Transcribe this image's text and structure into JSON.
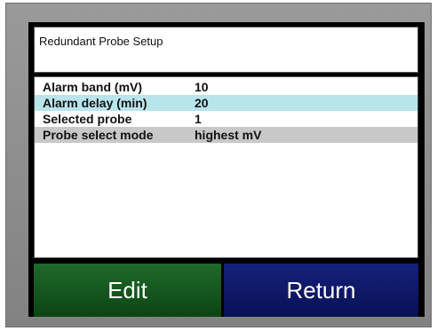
{
  "screen": {
    "title": "Redundant Probe Setup"
  },
  "settings": [
    {
      "label": "Alarm band (mV)",
      "value": "10"
    },
    {
      "label": "Alarm delay (min)",
      "value": "20"
    },
    {
      "label": "Selected probe",
      "value": "1"
    },
    {
      "label": "Probe select mode",
      "value": "highest mV"
    }
  ],
  "buttons": {
    "edit_label": "Edit",
    "return_label": "Return"
  },
  "colors": {
    "highlight_row": "#b9e4ec",
    "selected_row": "#c8c8c8",
    "edit_button": "#1f6a2a",
    "return_button": "#15217a"
  }
}
